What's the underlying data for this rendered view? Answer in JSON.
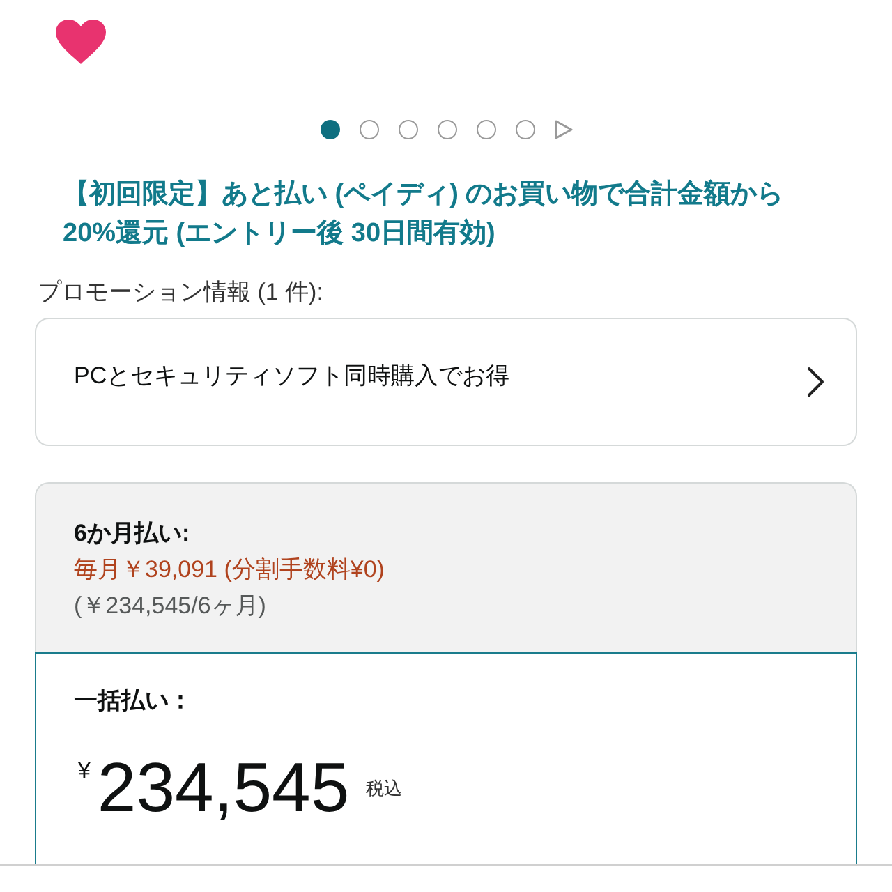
{
  "carousel": {
    "dots": [
      {
        "selected": true
      },
      {
        "selected": false
      },
      {
        "selected": false
      },
      {
        "selected": false
      },
      {
        "selected": false
      },
      {
        "selected": false
      }
    ]
  },
  "promo_headline": "【初回限定】あと払い (ペイディ) のお買い物で合計金額から20%還元 (エントリー後 30日間有効)",
  "promotions": {
    "label": "プロモーション情報 (1 件):",
    "items": [
      {
        "title": "PCとセキュリティソフト同時購入でお得"
      }
    ]
  },
  "payment_options": [
    {
      "kind": "installment",
      "selected": false,
      "title": "6か月払い:",
      "monthly": "毎月￥39,091 (分割手数料¥0)",
      "total": "(￥234,545/6ヶ月)"
    },
    {
      "kind": "lump_sum",
      "selected": true,
      "title": "一括払い：",
      "currency": "¥",
      "price": "234,545",
      "tax_note": "税込"
    }
  ]
}
